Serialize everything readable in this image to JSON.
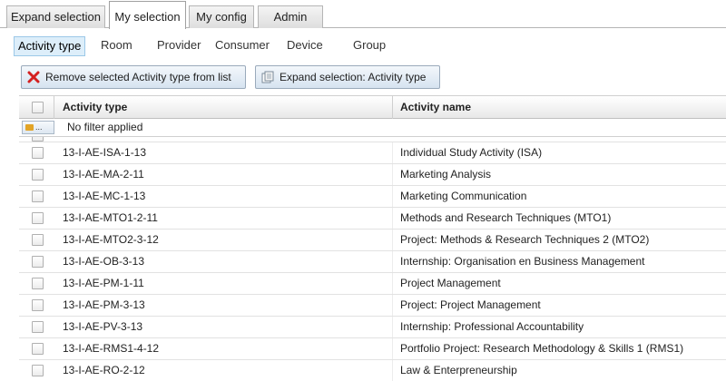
{
  "tabs": [
    {
      "label": "Expand selection"
    },
    {
      "label": "My selection"
    },
    {
      "label": "My config"
    },
    {
      "label": "Admin"
    }
  ],
  "active_tab": "My selection",
  "subnav": [
    {
      "label": "Activity type"
    },
    {
      "label": "Room"
    },
    {
      "label": "Provider"
    },
    {
      "label": "Consumer"
    },
    {
      "label": "Device"
    },
    {
      "label": "Group"
    }
  ],
  "active_subnav": "Activity type",
  "toolbar": {
    "remove_label": "Remove selected Activity type from list",
    "expand_label": "Expand selection: Activity type"
  },
  "grid": {
    "columns": [
      "Activity type",
      "Activity name"
    ],
    "filter_button": "...",
    "filter_text": "No filter applied",
    "rows": [
      {
        "type": "13-I-AE-ISA-1-13",
        "name": "Individual Study Activity (ISA)"
      },
      {
        "type": "13-I-AE-MA-2-11",
        "name": "Marketing Analysis"
      },
      {
        "type": "13-I-AE-MC-1-13",
        "name": "Marketing Communication"
      },
      {
        "type": "13-I-AE-MTO1-2-11",
        "name": "Methods and Research Techniques (MTO1)"
      },
      {
        "type": "13-I-AE-MTO2-3-12",
        "name": "Project: Methods & Research Techniques 2 (MTO2)"
      },
      {
        "type": "13-I-AE-OB-3-13",
        "name": "Internship: Organisation en Business Management"
      },
      {
        "type": "13-I-AE-PM-1-11",
        "name": "Project Management"
      },
      {
        "type": "13-I-AE-PM-3-13",
        "name": "Project: Project Management"
      },
      {
        "type": "13-I-AE-PV-3-13",
        "name": "Internship: Professional Accountability"
      },
      {
        "type": "13-I-AE-RMS1-4-12",
        "name": "Portfolio Project: Research Methodology & Skills 1 (RMS1)"
      },
      {
        "type": "13-I-AE-RO-2-12",
        "name": "Law & Enterpreneurship"
      }
    ]
  },
  "colors": {
    "remove_icon": "#d42020",
    "subnav_active_bg": "#ddeefa",
    "button_bg": "#d6e3f0"
  }
}
